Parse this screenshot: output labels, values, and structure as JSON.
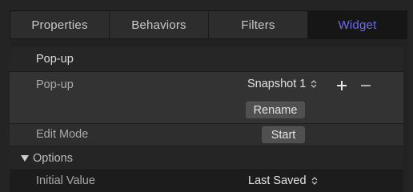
{
  "tabs": [
    {
      "label": "Properties",
      "active": false
    },
    {
      "label": "Behaviors",
      "active": false
    },
    {
      "label": "Filters",
      "active": false
    },
    {
      "label": "Widget",
      "active": true
    }
  ],
  "colors": {
    "active_tab": "#6b6cf0",
    "panel_bg": "#242424"
  },
  "section_title": "Pop-up",
  "popup_row": {
    "label": "Pop-up",
    "selected": "Snapshot 1",
    "add_icon": "plus-icon",
    "remove_icon": "minus-icon",
    "rename_label": "Rename"
  },
  "edit_mode": {
    "label": "Edit Mode",
    "button": "Start"
  },
  "options": {
    "label": "Options",
    "expanded": true
  },
  "initial_value": {
    "label": "Initial Value",
    "selected": "Last Saved"
  }
}
